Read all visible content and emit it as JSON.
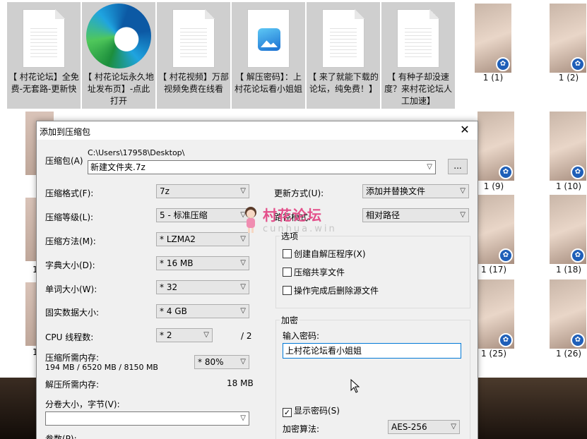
{
  "desktop": {
    "files": [
      {
        "label": "【 村花论坛】全免费-无套路-更新快",
        "kind": "text"
      },
      {
        "label": "【 村花论坛永久地址发布页】-点此打开",
        "kind": "edge"
      },
      {
        "label": "【 村花视频】万部视频免费在线看",
        "kind": "text"
      },
      {
        "label": "【 解压密码】：上村花论坛看小姐姐",
        "kind": "image"
      },
      {
        "label": "【 来了就能下载的论坛，纯免费！】",
        "kind": "text"
      },
      {
        "label": "【 有种子却没速度？来村花论坛人工加速】",
        "kind": "text"
      }
    ],
    "thumb_labels": [
      "1 (1)",
      "1 (2)",
      "1 (9)",
      "1 (10)",
      "1 (17)",
      "1 (18)",
      "1 (25)",
      "1 (26)"
    ],
    "left_strip_labels": [
      "1",
      "1",
      "1"
    ]
  },
  "dialog": {
    "title": "添加到压缩包",
    "close_glyph": "✕",
    "archive_label": "压缩包(A)",
    "archive_path": "C:\\Users\\17958\\Desktop\\",
    "archive_name": "新建文件夹.7z",
    "browse_label": "...",
    "format_label": "压缩格式(F):",
    "format_value": "7z",
    "level_label": "压缩等级(L):",
    "level_value": "5 - 标准压缩",
    "method_label": "压缩方法(M):",
    "method_value": "* LZMA2",
    "dict_label": "字典大小(D):",
    "dict_value": "* 16 MB",
    "word_label": "单词大小(W):",
    "word_value": "* 32",
    "solid_label": "固实数据大小:",
    "solid_value": "* 4 GB",
    "cpu_label": "CPU 线程数:",
    "cpu_value": "* 2",
    "cpu_total": "/ 2",
    "mem_comp_label": "压缩所需内存:",
    "mem_comp_value": "194 MB / 6520 MB / 8150 MB",
    "mem_pct_value": "* 80%",
    "mem_decomp_label": "解压所需内存:",
    "mem_decomp_value": "18 MB",
    "volume_label": "分卷大小，字节(V):",
    "volume_value": "",
    "params_label": "参数(P):",
    "update_label": "更新方式(U):",
    "update_value": "添加并替换文件",
    "pathmode_label": "路径模式:",
    "pathmode_value": "相对路径",
    "options_title": "选项",
    "opt_sfx": "创建自解压程序(X)",
    "opt_shared": "压缩共享文件",
    "opt_delete": "操作完成后删除源文件",
    "encrypt_title": "加密",
    "pw_label": "输入密码:",
    "pw_value": "上村花论坛看小姐姐",
    "show_pw_label": "显示密码(S)",
    "enc_method_label": "加密算法:",
    "enc_method_value": "AES-256"
  },
  "watermark": {
    "title": "村花论坛",
    "sub": "cunhua.win"
  }
}
